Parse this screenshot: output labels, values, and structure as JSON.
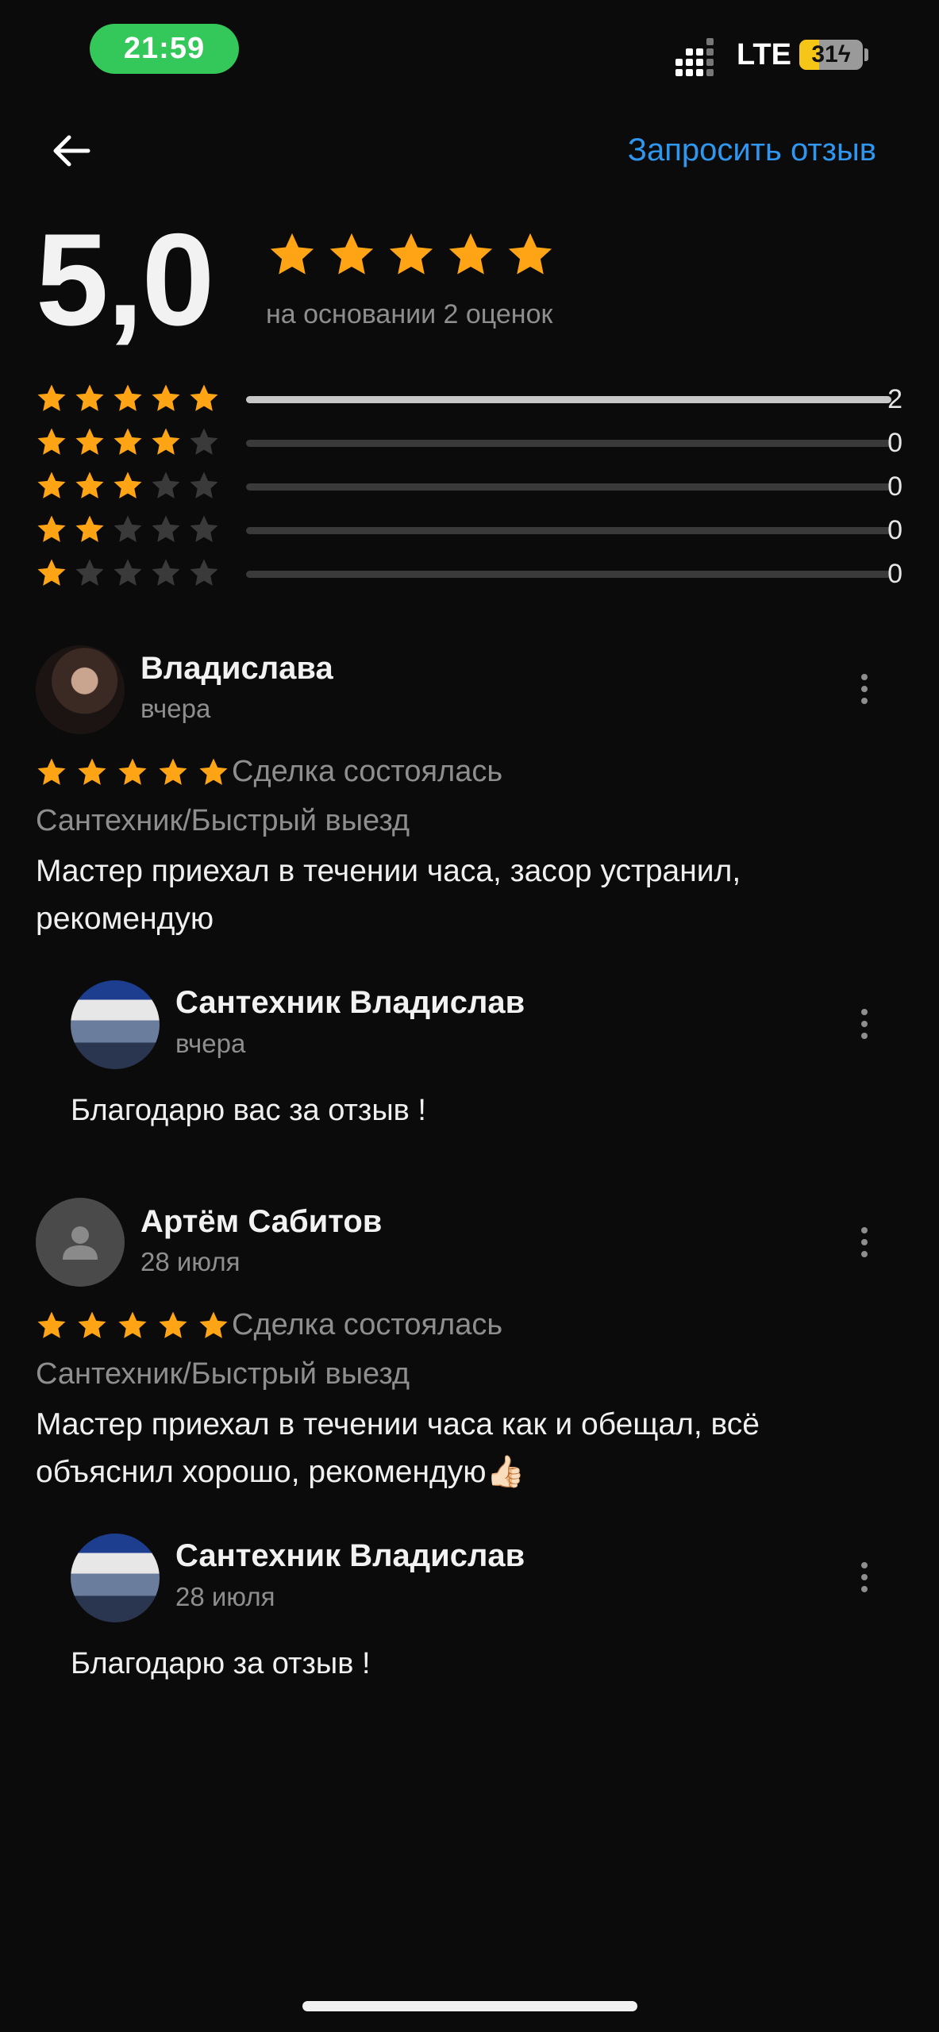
{
  "status_bar": {
    "time": "21:59",
    "network": "LTE",
    "battery": "31",
    "battery_level": 0.31,
    "colors": {
      "time_pill": "#34c759",
      "battery_fill": "#f5c518"
    }
  },
  "header": {
    "back_icon": "arrow-left-icon",
    "request_review": "Запросить отзыв",
    "link_color": "#2f97ef"
  },
  "summary": {
    "score": "5,0",
    "stars": 5,
    "caption": "на основании 2 оценок",
    "star_color": "#ffa414"
  },
  "distribution": [
    {
      "stars": 5,
      "count": "2",
      "fraction": 1.0
    },
    {
      "stars": 4,
      "count": "0",
      "fraction": 0
    },
    {
      "stars": 3,
      "count": "0",
      "fraction": 0
    },
    {
      "stars": 2,
      "count": "0",
      "fraction": 0
    },
    {
      "stars": 1,
      "count": "0",
      "fraction": 0
    }
  ],
  "reviews": [
    {
      "author": "Владислава",
      "date": "вчера",
      "rating": 5,
      "deal_status": "Сделка состоялась",
      "category": "Сантехник/Быстрый выезд",
      "text": "Мастер приехал в течении часа, засор устранил, рекомендую",
      "reply": {
        "author": "Сантехник Владислав",
        "date": "вчера",
        "text": "Благодарю вас за отзыв !"
      }
    },
    {
      "author": "Артём Сабитов",
      "date": "28 июля",
      "rating": 5,
      "deal_status": "Сделка состоялась",
      "category": "Сантехник/Быстрый выезд",
      "text": "Мастер приехал в течении часа как и обещал, всё объяснил хорошо, рекомендую👍🏻",
      "reply": {
        "author": "Сантехник Владислав",
        "date": "28 июля",
        "text": "Благодарю за отзыв !"
      }
    }
  ]
}
